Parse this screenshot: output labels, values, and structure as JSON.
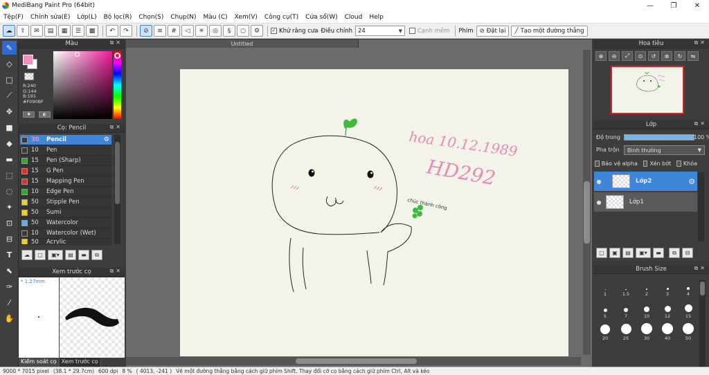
{
  "window": {
    "title": "MediBang Paint Pro (64bit)",
    "controls": [
      "—",
      "❐",
      "✕"
    ]
  },
  "menu": [
    "Tệp(F)",
    "Chỉnh sửa(E)",
    "Lớp(L)",
    "Bộ lọc(R)",
    "Chọn(S)",
    "Chụp(N)",
    "Màu (C)",
    "Xem(V)",
    "Công cụ(T)",
    "Cửa sổ(W)",
    "Cloud",
    "Help"
  ],
  "toolbar": {
    "antialias_label": "Khử răng cưa",
    "adjust_label": "Điều chỉnh",
    "adjust_value": "24",
    "edge_label": "Cạnh mềm",
    "key_label": "Phím",
    "reset_label": "Đặt lại",
    "make_line_label": "Tạo một đường thẳng"
  },
  "color_panel": {
    "title": "Màu",
    "readout": "R:240\nG:144\nB:191\n#F090BF",
    "fg_color": "#f090bf"
  },
  "brush_panel": {
    "title": "Cọ: Pencil",
    "items": [
      {
        "size": "30",
        "name": "Pencil",
        "color": "#3a3a3a"
      },
      {
        "size": "10",
        "name": "Pen",
        "color": "#3a3a3a"
      },
      {
        "size": "15",
        "name": "Pen (Sharp)",
        "color": "#2fa82f"
      },
      {
        "size": "15",
        "name": "G Pen",
        "color": "#e03030"
      },
      {
        "size": "15",
        "name": "Mapping Pen",
        "color": "#e03030"
      },
      {
        "size": "10",
        "name": "Edge Pen",
        "color": "#2fa82f"
      },
      {
        "size": "50",
        "name": "Stipple Pen",
        "color": "#e8d230"
      },
      {
        "size": "50",
        "name": "Sumi",
        "color": "#e8d230"
      },
      {
        "size": "50",
        "name": "Watercolor",
        "color": "#5ab0e8"
      },
      {
        "size": "10",
        "name": "Watercolor (Wet)",
        "color": "#3a3a3a"
      },
      {
        "size": "50",
        "name": "Acrylic",
        "color": "#e8d230"
      }
    ]
  },
  "preview_panel": {
    "title": "Xem trước cọ",
    "size_label": "* 1.27mm",
    "tabs": [
      "Kiểm soát cọ",
      "Xem trước cọ"
    ]
  },
  "document": {
    "tab_title": "Untitled"
  },
  "navigator": {
    "title": "Hoa tiêu"
  },
  "layer_panel": {
    "title": "Lớp",
    "opacity_label": "Độ trong",
    "opacity_value": "100 %",
    "opacity_fraction": 1.0,
    "blend_label": "Pha trộn",
    "blend_value": "Bình thường",
    "protect_alpha": "Bảo vệ alpha",
    "clipping": "Xén bớt",
    "lock": "Khóa",
    "layers": [
      {
        "name": "Lớp2",
        "selected": true
      },
      {
        "name": "Lớp1",
        "selected": false
      }
    ]
  },
  "brush_size_panel": {
    "title": "Brush Size",
    "sizes": [
      "1",
      "1.5",
      "2",
      "3",
      "4",
      "5",
      "7",
      "10",
      "12",
      "15",
      "20",
      "25",
      "30",
      "40",
      "50"
    ]
  },
  "status_bar": {
    "size": "9000 * 7015 pixel",
    "cm": "(38.1 * 29.7cm)",
    "dpi": "600 dpi",
    "zoom": "8 %",
    "coords": "( 4013, -241 )",
    "hint": "Vẽ một đường thẳng bằng cách giữ phím Shift. Thay đổi cỡ cọ bằng cách giữ phím Ctrl, Alt và kéo"
  },
  "artwork": {
    "handwriting_line1": "hoa 10.12.1989",
    "handwriting_line2": "HD292",
    "note": "chúc thành công"
  }
}
